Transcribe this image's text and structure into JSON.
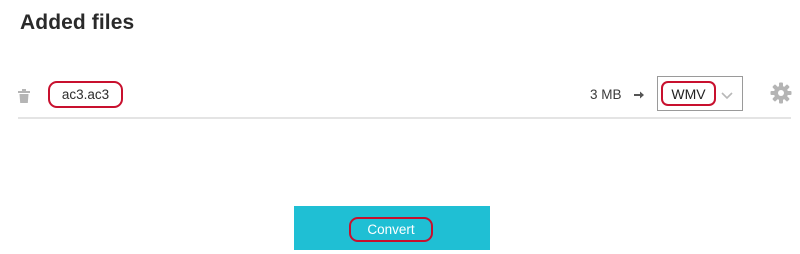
{
  "header": {
    "title": "Added files"
  },
  "file": {
    "name": "ac3.ac3",
    "size": "3 MB",
    "target_format": "WMV"
  },
  "icons": {
    "delete": "trash-icon",
    "arrow": "arrow-right-icon",
    "dropdown": "chevron-down-icon",
    "settings": "gear-icon"
  },
  "actions": {
    "convert_label": "Convert"
  },
  "colors": {
    "accent": "#1fbfd4",
    "highlight": "#c8102e",
    "icon_gray": "#b5b5b5"
  }
}
